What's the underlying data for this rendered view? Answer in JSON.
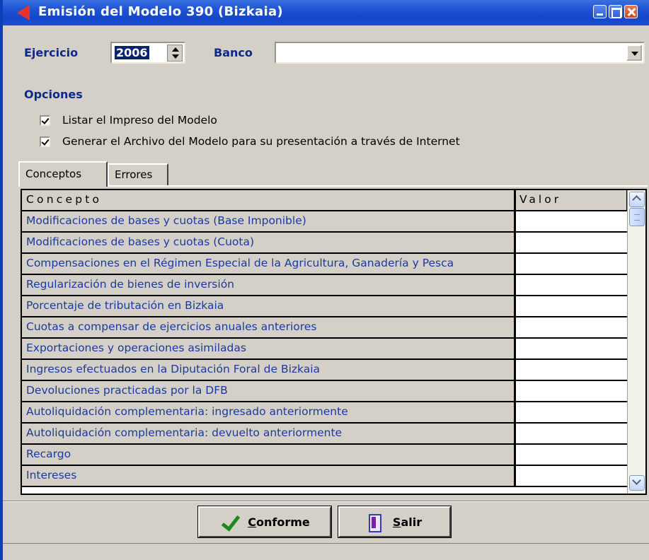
{
  "window": {
    "title": "Emisión del Modelo 390 (Bizkaia)"
  },
  "form": {
    "ejercicio_label": "Ejercicio",
    "ejercicio_value": "2006",
    "banco_label": "Banco",
    "banco_value": ""
  },
  "opciones": {
    "title": "Opciones",
    "items": [
      {
        "label": "Listar el Impreso del Modelo",
        "checked": true
      },
      {
        "label": "Generar el Archivo del Modelo para su presentación a través de Internet",
        "checked": true
      }
    ]
  },
  "tabs": [
    {
      "label": "Conceptos",
      "active": true
    },
    {
      "label": "Errores",
      "active": false
    }
  ],
  "grid": {
    "columns": [
      "Concepto",
      "Valor"
    ],
    "rows": [
      {
        "concepto": "Modificaciones de bases y cuotas (Base Imponible)",
        "valor": ""
      },
      {
        "concepto": "Modificaciones de bases y cuotas (Cuota)",
        "valor": ""
      },
      {
        "concepto": "Compensaciones en el Régimen Especial de la Agricultura, Ganadería y Pesca",
        "valor": ""
      },
      {
        "concepto": "Regularización de bienes de inversión",
        "valor": ""
      },
      {
        "concepto": "Porcentaje de tributación en Bizkaia",
        "valor": ""
      },
      {
        "concepto": "Cuotas a compensar de ejercicios anuales anteriores",
        "valor": ""
      },
      {
        "concepto": "Exportaciones y operaciones asimiladas",
        "valor": ""
      },
      {
        "concepto": "Ingresos efectuados en la Diputación Foral de Bizkaia",
        "valor": ""
      },
      {
        "concepto": "Devoluciones practicadas por la DFB",
        "valor": ""
      },
      {
        "concepto": "Autoliquidación complementaria: ingresado anteriormente",
        "valor": ""
      },
      {
        "concepto": "Autoliquidación complementaria: devuelto anteriormente",
        "valor": ""
      },
      {
        "concepto": "Recargo",
        "valor": ""
      },
      {
        "concepto": "Intereses",
        "valor": ""
      }
    ]
  },
  "buttons": {
    "conforme_first": "C",
    "conforme_rest": "onforme",
    "salir_first": "S",
    "salir_rest": "alir"
  },
  "colors": {
    "title_bar": "#1447c8",
    "window_bg": "#d4d0c8",
    "concept_text": "#1a3aa0",
    "label_bold": "#0d2a8a",
    "check_green": "#1a8a1a"
  },
  "icons": {
    "title": "app-arrow-icon",
    "conforme": "checkmark-icon",
    "salir": "exit-door-icon"
  }
}
